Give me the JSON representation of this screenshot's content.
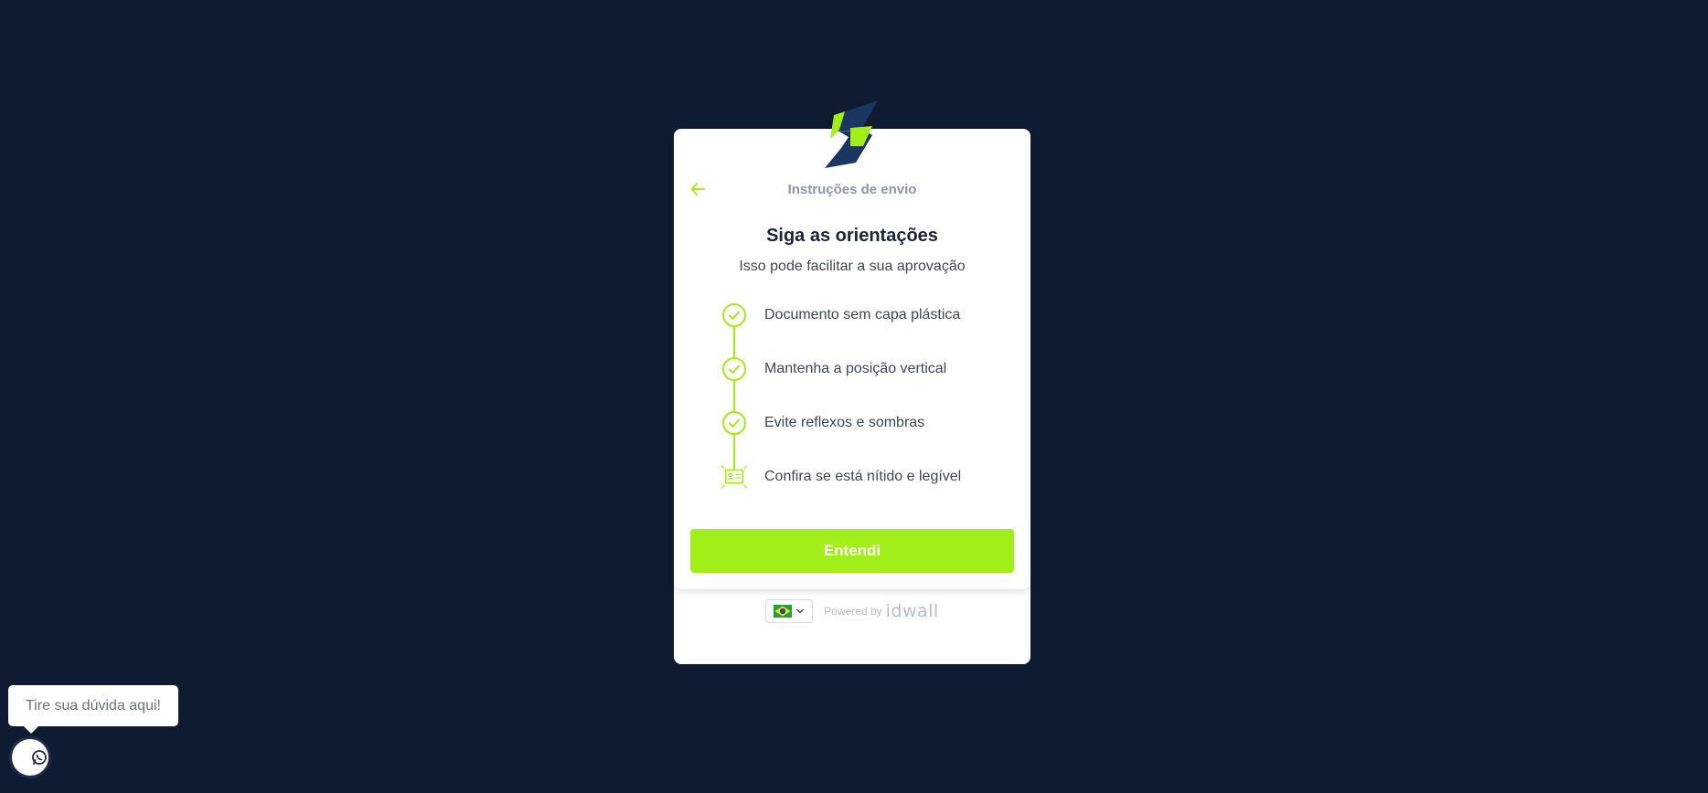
{
  "colors": {
    "background": "#0f1b31",
    "accent": "#a2ee18",
    "logo_dark": "#1b3660",
    "title": "#1a2438",
    "muted": "#8e96a8"
  },
  "logo": {
    "icon": "brand-logo-icon"
  },
  "header": {
    "back_icon": "arrow-left-icon",
    "title": "Instruções de envio"
  },
  "main": {
    "title": "Siga as orientações",
    "subtitle": "Isso pode facilitar a sua aprovação",
    "steps": [
      {
        "icon": "check-circle-icon",
        "label": "Documento sem capa plástica"
      },
      {
        "icon": "check-circle-icon",
        "label": "Mantenha a posição vertical"
      },
      {
        "icon": "check-circle-icon",
        "label": "Evite reflexos e sombras"
      },
      {
        "icon": "id-card-icon",
        "label": "Confira se está nítido e legível"
      }
    ],
    "confirm_label": "Entendi"
  },
  "footer": {
    "language_icon": "brazil-flag-icon",
    "powered_by": "Powered by",
    "brand_name": "idwall"
  },
  "chat": {
    "tooltip": "Tire sua dúvida aqui!",
    "icon": "whatsapp-icon"
  }
}
